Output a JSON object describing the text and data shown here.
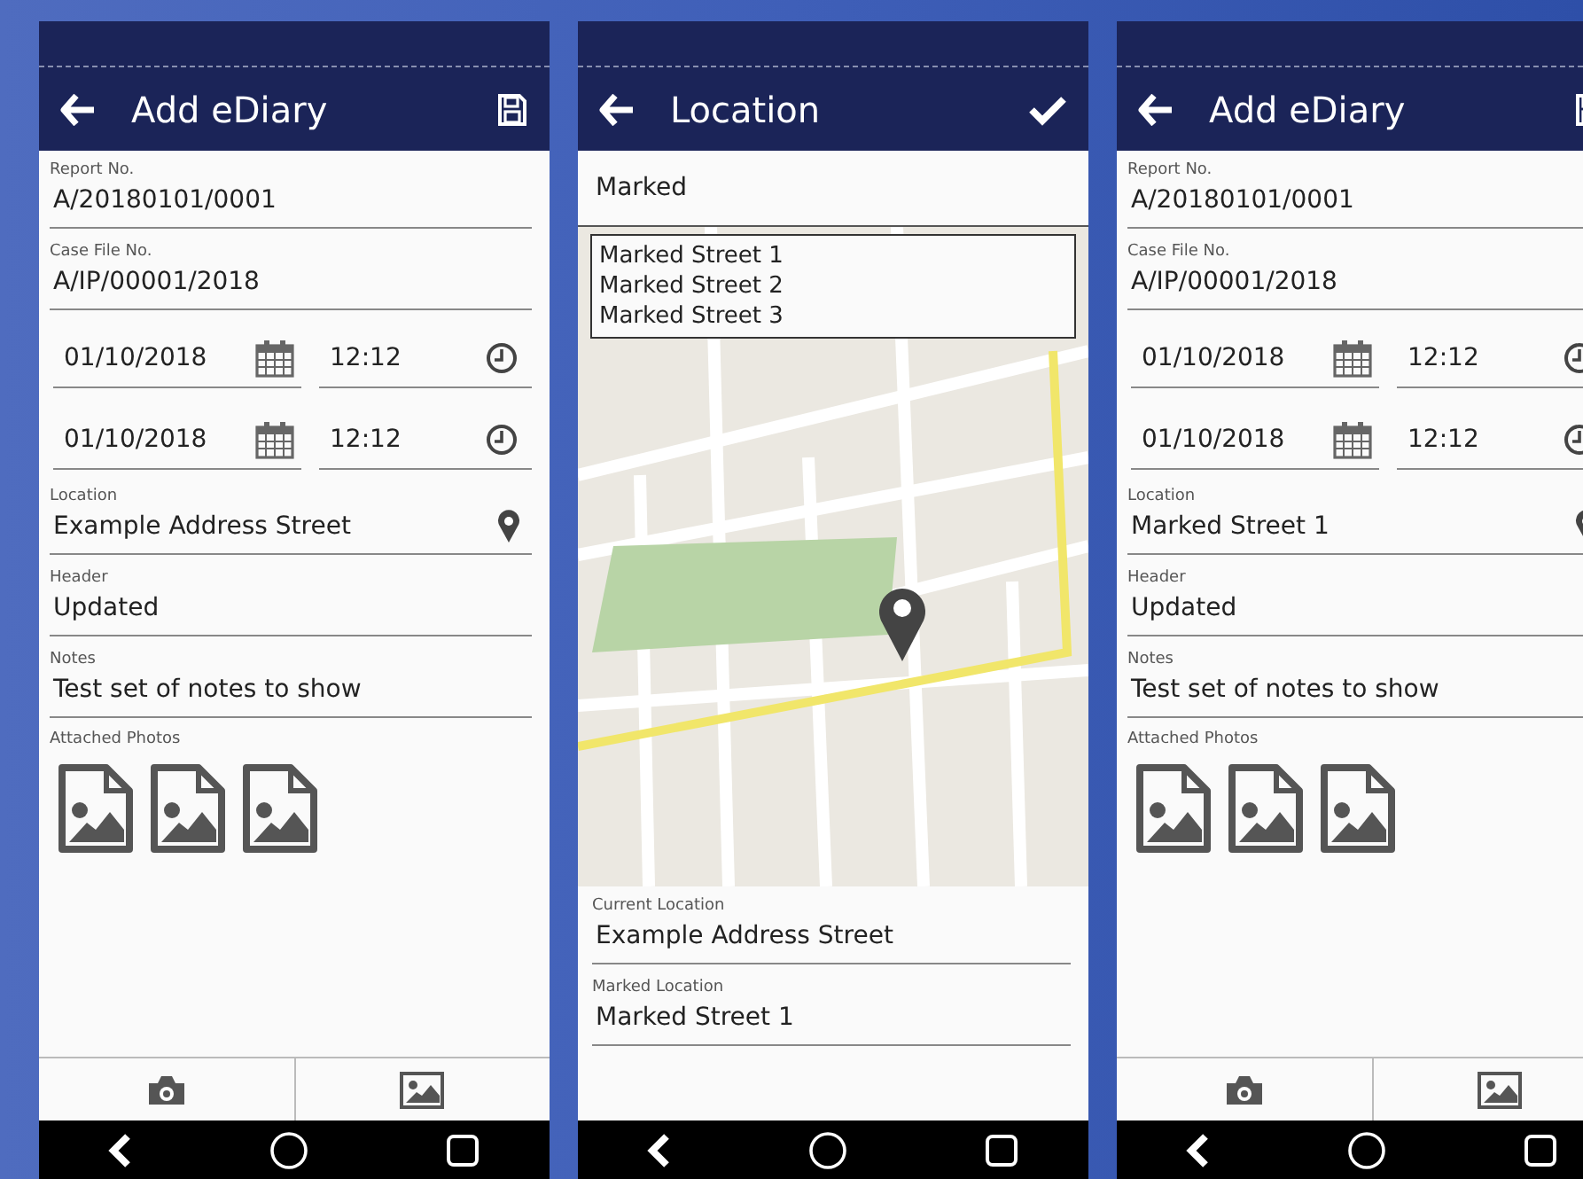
{
  "screens": [
    {
      "kind": "form",
      "title": "Add eDiary",
      "fields": [
        {
          "kind": "text",
          "label": "Report No.",
          "value": "A/20180101/0001"
        },
        {
          "kind": "text",
          "label": "Case File No.",
          "value": "A/IP/00001/2018"
        },
        {
          "kind": "datetime",
          "date": "01/10/2018",
          "time": "12:12"
        },
        {
          "kind": "datetime",
          "date": "01/10/2018",
          "time": "12:12"
        },
        {
          "kind": "location",
          "label": "Location",
          "value": "Example Address Street"
        },
        {
          "kind": "text",
          "label": "Header",
          "value": "Updated"
        },
        {
          "kind": "text",
          "label": "Notes",
          "value": "Test set of notes to show"
        }
      ],
      "photos_label": "Attached Photos",
      "photos": [
        {
          "kind": "image"
        },
        {
          "kind": "image"
        },
        {
          "kind": "image"
        }
      ]
    },
    {
      "kind": "location",
      "title": "Location",
      "search": {
        "value": "Marked"
      },
      "suggestions": [
        "Marked Street 1",
        "Marked Street 2",
        "Marked Street 3"
      ],
      "fields": [
        {
          "kind": "text",
          "label": "Current Location",
          "value": "Example Address Street"
        },
        {
          "kind": "text",
          "label": "Marked Location",
          "value": "Marked Street 1"
        }
      ]
    },
    {
      "kind": "form",
      "title": "Add eDiary",
      "fields": [
        {
          "kind": "text",
          "label": "Report No.",
          "value": "A/20180101/0001"
        },
        {
          "kind": "text",
          "label": "Case File No.",
          "value": "A/IP/00001/2018"
        },
        {
          "kind": "datetime",
          "date": "01/10/2018",
          "time": "12:12"
        },
        {
          "kind": "datetime",
          "date": "01/10/2018",
          "time": "12:12"
        },
        {
          "kind": "location",
          "label": "Location",
          "value": "Marked Street 1"
        },
        {
          "kind": "text",
          "label": "Header",
          "value": "Updated"
        },
        {
          "kind": "text",
          "label": "Notes",
          "value": "Test set of notes to show"
        }
      ],
      "photos_label": "Attached Photos",
      "photos": [
        {
          "kind": "image"
        },
        {
          "kind": "image"
        },
        {
          "kind": "image"
        }
      ]
    }
  ]
}
